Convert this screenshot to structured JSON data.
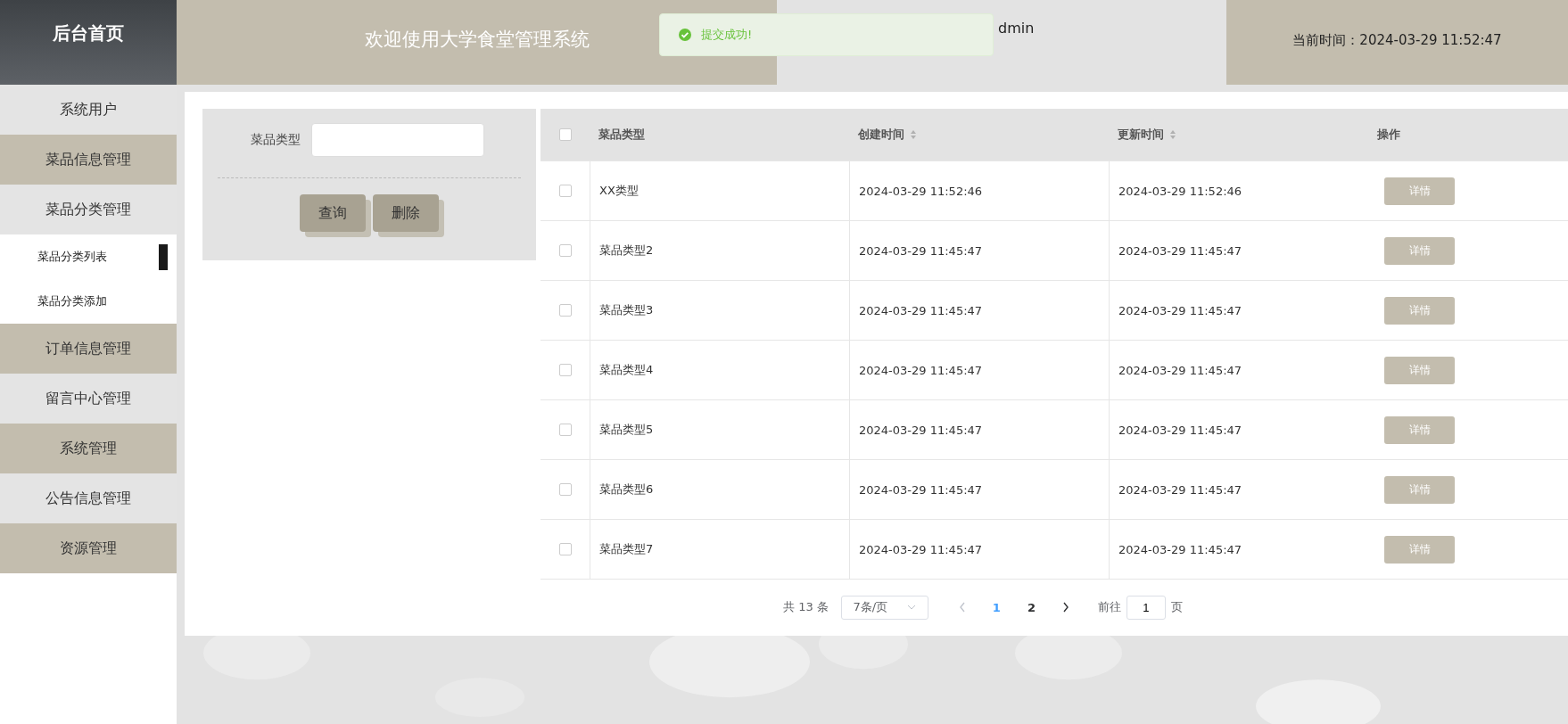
{
  "header": {
    "brand": "后台首页",
    "title": "欢迎使用大学食堂管理系统",
    "user": "dmin",
    "time_label": "当前时间：",
    "time": "2024-03-29 11:52:47"
  },
  "toast": {
    "kind": "success",
    "text": "提交成功!"
  },
  "sidebar": {
    "items": [
      {
        "label": "系统用户",
        "selected": false
      },
      {
        "label": "菜品信息管理",
        "selected": false
      },
      {
        "label": "菜品分类管理",
        "selected": false,
        "children": [
          {
            "label": "菜品分类列表",
            "selected": true
          },
          {
            "label": "菜品分类添加",
            "selected": false
          }
        ]
      },
      {
        "label": "订单信息管理",
        "selected": false
      },
      {
        "label": "留言中心管理",
        "selected": false
      },
      {
        "label": "系统管理",
        "selected": false
      },
      {
        "label": "公告信息管理",
        "selected": false
      },
      {
        "label": "资源管理",
        "selected": false
      }
    ]
  },
  "search": {
    "label": "菜品类型",
    "buttons": [
      "查询",
      "删除"
    ]
  },
  "table": {
    "all_checked": false,
    "columns": [
      {
        "label": "菜品类型",
        "sortable": false
      },
      {
        "label": "创建时间",
        "sortable": true
      },
      {
        "label": "更新时间",
        "sortable": true
      },
      {
        "label": "操作",
        "sortable": false
      }
    ],
    "rows": [
      {
        "checked": false,
        "type": "XX类型",
        "created": "2024-03-29 11:52:46",
        "updated": "2024-03-29 11:52:46",
        "action": "详情"
      },
      {
        "checked": false,
        "type": "菜品类型2",
        "created": "2024-03-29 11:45:47",
        "updated": "2024-03-29 11:45:47",
        "action": "详情"
      },
      {
        "checked": false,
        "type": "菜品类型3",
        "created": "2024-03-29 11:45:47",
        "updated": "2024-03-29 11:45:47",
        "action": "详情"
      },
      {
        "checked": false,
        "type": "菜品类型4",
        "created": "2024-03-29 11:45:47",
        "updated": "2024-03-29 11:45:47",
        "action": "详情"
      },
      {
        "checked": false,
        "type": "菜品类型5",
        "created": "2024-03-29 11:45:47",
        "updated": "2024-03-29 11:45:47",
        "action": "详情"
      },
      {
        "checked": false,
        "type": "菜品类型6",
        "created": "2024-03-29 11:45:47",
        "updated": "2024-03-29 11:45:47",
        "action": "详情"
      },
      {
        "checked": false,
        "type": "菜品类型7",
        "created": "2024-03-29 11:45:47",
        "updated": "2024-03-29 11:45:47",
        "action": "详情"
      }
    ]
  },
  "pagination": {
    "total": "共 13 条",
    "page_size": "7条/页",
    "pages": [
      {
        "label": "1",
        "selected": true
      },
      {
        "label": "2",
        "selected": false
      }
    ],
    "goto_label": "前往",
    "goto_value": "1",
    "goto_suffix": "页"
  }
}
